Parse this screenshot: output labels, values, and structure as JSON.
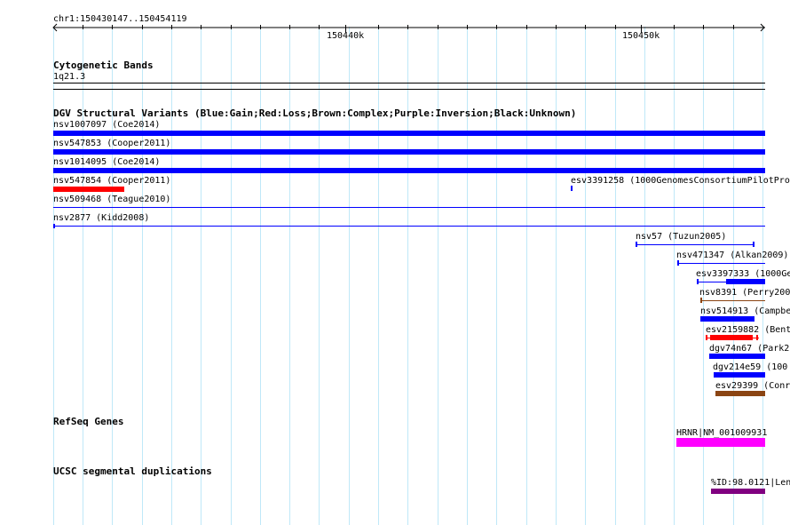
{
  "ruler": {
    "position": "chr1:150430147..150454119",
    "major_labels": [
      "150440k",
      "150450k"
    ]
  },
  "cytoband": {
    "title": "Cytogenetic Bands",
    "band": "1q21.3"
  },
  "dgv": {
    "title": "DGV Structural Variants (Blue:Gain;Red:Loss;Brown:Complex;Purple:Inversion;Black:Unknown)",
    "colors": {
      "gain": "#0000ff",
      "loss": "#ff0000",
      "complex": "#8b4513",
      "inversion": "#800080",
      "unknown": "#000000"
    },
    "variants": [
      {
        "label": "nsv1007097 (Coe2014)"
      },
      {
        "label": "nsv547853 (Cooper2011)"
      },
      {
        "label": "nsv1014095 (Coe2014)"
      },
      {
        "label": "nsv547854 (Cooper2011)"
      },
      {
        "label": "esv3391258 (1000GenomesConsortiumPilotProj"
      },
      {
        "label": "nsv509468 (Teague2010)"
      },
      {
        "label": "nsv2877 (Kidd2008)"
      },
      {
        "label": "nsv57 (Tuzun2005)"
      },
      {
        "label": "nsv471347 (Alkan2009)"
      },
      {
        "label": "esv3397333 (1000Ge"
      },
      {
        "label": "nsv8391 (Perry200"
      },
      {
        "label": "nsv514913 (Campbe"
      },
      {
        "label": "esv2159882 (Bent"
      },
      {
        "label": "dgv74n67 (Park2"
      },
      {
        "label": "dgv214e59 (100"
      },
      {
        "label": "esv29399 (Conr"
      }
    ]
  },
  "refseq": {
    "title": "RefSeq Genes",
    "gene_label": "HRNR|NM_001009931",
    "color": "#ff00ff"
  },
  "segdup": {
    "title": "UCSC segmental duplications",
    "label": "%ID:98.0121|Len",
    "color": "#800080"
  }
}
